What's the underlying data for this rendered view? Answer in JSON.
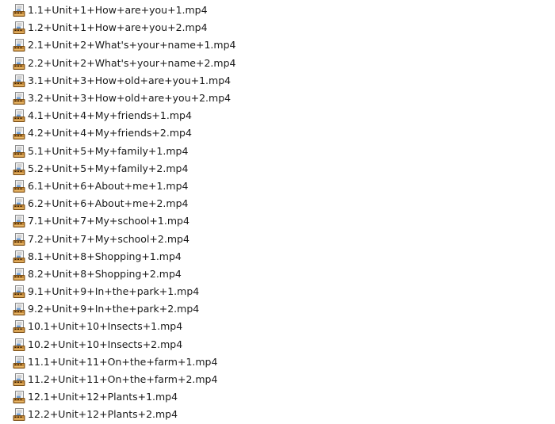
{
  "file_list": {
    "icon": "video-file-icon",
    "files": [
      "1.1+Unit+1+How+are+you+1.mp4",
      "1.2+Unit+1+How+are+you+2.mp4",
      "2.1+Unit+2+What's+your+name+1.mp4",
      "2.2+Unit+2+What's+your+name+2.mp4",
      "3.1+Unit+3+How+old+are+you+1.mp4",
      "3.2+Unit+3+How+old+are+you+2.mp4",
      "4.1+Unit+4+My+friends+1.mp4",
      "4.2+Unit+4+My+friends+2.mp4",
      "5.1+Unit+5+My+family+1.mp4",
      "5.2+Unit+5+My+family+2.mp4",
      "6.1+Unit+6+About+me+1.mp4",
      "6.2+Unit+6+About+me+2.mp4",
      "7.1+Unit+7+My+school+1.mp4",
      "7.2+Unit+7+My+school+2.mp4",
      "8.1+Unit+8+Shopping+1.mp4",
      "8.2+Unit+8+Shopping+2.mp4",
      "9.1+Unit+9+In+the+park+1.mp4",
      "9.2+Unit+9+In+the+park+2.mp4",
      "10.1+Unit+10+Insects+1.mp4",
      "10.2+Unit+10+Insects+2.mp4",
      "11.1+Unit+11+On+the+farm+1.mp4",
      "11.2+Unit+11+On+the+farm+2.mp4",
      "12.1+Unit+12+Plants+1.mp4",
      "12.2+Unit+12+Plants+2.mp4"
    ]
  }
}
